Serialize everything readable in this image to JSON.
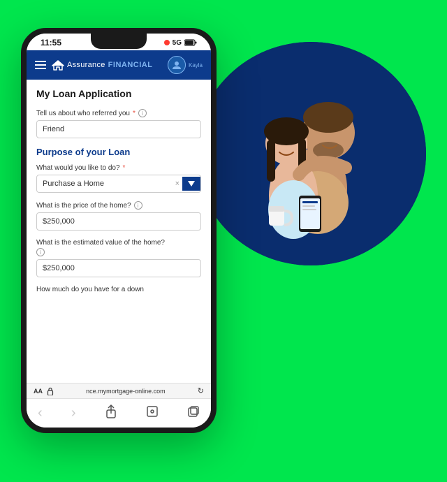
{
  "background": {
    "color": "#00e64d"
  },
  "status_bar": {
    "time": "11:55",
    "signal": "5G",
    "battery": "■"
  },
  "navbar": {
    "brand_assurance": "Assurance",
    "brand_financial": "FINANCIAL",
    "user_label": "Kayla"
  },
  "page": {
    "title": "My Loan Application"
  },
  "form": {
    "referral_label": "Tell us about who referred you",
    "referral_value": "Friend",
    "section_title": "Purpose of your Loan",
    "loan_purpose_label": "What would you like to do?",
    "loan_purpose_value": "Purchase a Home",
    "home_price_label": "What is the price of the home?",
    "home_price_value": "$250,000",
    "home_value_label": "What is the estimated value of the home?",
    "home_value_info": "ⓘ",
    "home_value_value": "$250,000",
    "down_payment_label": "How much do you have for a down"
  },
  "browser_bar": {
    "text_size": "AA",
    "url": "nce.mymortgage-online.com",
    "reload_icon": "↻"
  },
  "nav_icons": {
    "back": "‹",
    "forward": "›",
    "share": "⬆",
    "bookmarks": "□",
    "tabs": "⧉"
  }
}
